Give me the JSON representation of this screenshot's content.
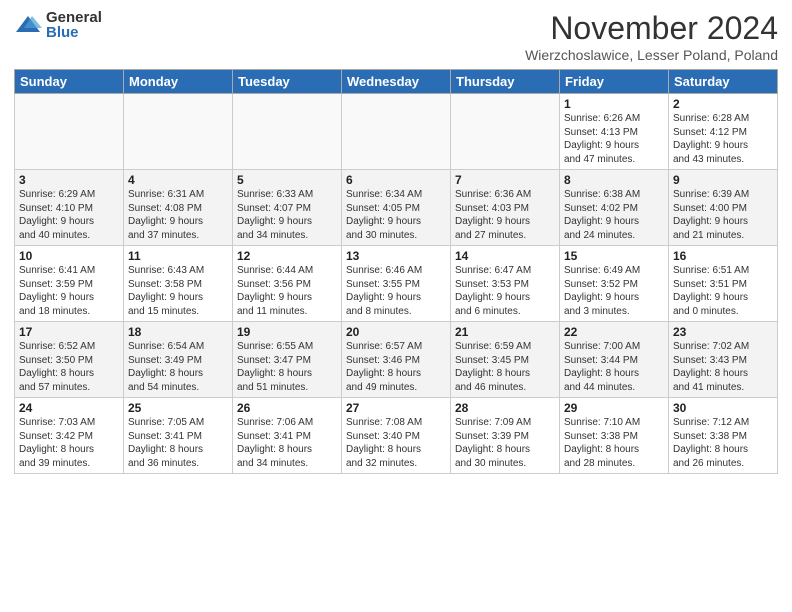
{
  "logo": {
    "general": "General",
    "blue": "Blue"
  },
  "title": "November 2024",
  "location": "Wierzchoslawice, Lesser Poland, Poland",
  "days_header": [
    "Sunday",
    "Monday",
    "Tuesday",
    "Wednesday",
    "Thursday",
    "Friday",
    "Saturday"
  ],
  "weeks": [
    [
      {
        "day": "",
        "info": ""
      },
      {
        "day": "",
        "info": ""
      },
      {
        "day": "",
        "info": ""
      },
      {
        "day": "",
        "info": ""
      },
      {
        "day": "",
        "info": ""
      },
      {
        "day": "1",
        "info": "Sunrise: 6:26 AM\nSunset: 4:13 PM\nDaylight: 9 hours\nand 47 minutes."
      },
      {
        "day": "2",
        "info": "Sunrise: 6:28 AM\nSunset: 4:12 PM\nDaylight: 9 hours\nand 43 minutes."
      }
    ],
    [
      {
        "day": "3",
        "info": "Sunrise: 6:29 AM\nSunset: 4:10 PM\nDaylight: 9 hours\nand 40 minutes."
      },
      {
        "day": "4",
        "info": "Sunrise: 6:31 AM\nSunset: 4:08 PM\nDaylight: 9 hours\nand 37 minutes."
      },
      {
        "day": "5",
        "info": "Sunrise: 6:33 AM\nSunset: 4:07 PM\nDaylight: 9 hours\nand 34 minutes."
      },
      {
        "day": "6",
        "info": "Sunrise: 6:34 AM\nSunset: 4:05 PM\nDaylight: 9 hours\nand 30 minutes."
      },
      {
        "day": "7",
        "info": "Sunrise: 6:36 AM\nSunset: 4:03 PM\nDaylight: 9 hours\nand 27 minutes."
      },
      {
        "day": "8",
        "info": "Sunrise: 6:38 AM\nSunset: 4:02 PM\nDaylight: 9 hours\nand 24 minutes."
      },
      {
        "day": "9",
        "info": "Sunrise: 6:39 AM\nSunset: 4:00 PM\nDaylight: 9 hours\nand 21 minutes."
      }
    ],
    [
      {
        "day": "10",
        "info": "Sunrise: 6:41 AM\nSunset: 3:59 PM\nDaylight: 9 hours\nand 18 minutes."
      },
      {
        "day": "11",
        "info": "Sunrise: 6:43 AM\nSunset: 3:58 PM\nDaylight: 9 hours\nand 15 minutes."
      },
      {
        "day": "12",
        "info": "Sunrise: 6:44 AM\nSunset: 3:56 PM\nDaylight: 9 hours\nand 11 minutes."
      },
      {
        "day": "13",
        "info": "Sunrise: 6:46 AM\nSunset: 3:55 PM\nDaylight: 9 hours\nand 8 minutes."
      },
      {
        "day": "14",
        "info": "Sunrise: 6:47 AM\nSunset: 3:53 PM\nDaylight: 9 hours\nand 6 minutes."
      },
      {
        "day": "15",
        "info": "Sunrise: 6:49 AM\nSunset: 3:52 PM\nDaylight: 9 hours\nand 3 minutes."
      },
      {
        "day": "16",
        "info": "Sunrise: 6:51 AM\nSunset: 3:51 PM\nDaylight: 9 hours\nand 0 minutes."
      }
    ],
    [
      {
        "day": "17",
        "info": "Sunrise: 6:52 AM\nSunset: 3:50 PM\nDaylight: 8 hours\nand 57 minutes."
      },
      {
        "day": "18",
        "info": "Sunrise: 6:54 AM\nSunset: 3:49 PM\nDaylight: 8 hours\nand 54 minutes."
      },
      {
        "day": "19",
        "info": "Sunrise: 6:55 AM\nSunset: 3:47 PM\nDaylight: 8 hours\nand 51 minutes."
      },
      {
        "day": "20",
        "info": "Sunrise: 6:57 AM\nSunset: 3:46 PM\nDaylight: 8 hours\nand 49 minutes."
      },
      {
        "day": "21",
        "info": "Sunrise: 6:59 AM\nSunset: 3:45 PM\nDaylight: 8 hours\nand 46 minutes."
      },
      {
        "day": "22",
        "info": "Sunrise: 7:00 AM\nSunset: 3:44 PM\nDaylight: 8 hours\nand 44 minutes."
      },
      {
        "day": "23",
        "info": "Sunrise: 7:02 AM\nSunset: 3:43 PM\nDaylight: 8 hours\nand 41 minutes."
      }
    ],
    [
      {
        "day": "24",
        "info": "Sunrise: 7:03 AM\nSunset: 3:42 PM\nDaylight: 8 hours\nand 39 minutes."
      },
      {
        "day": "25",
        "info": "Sunrise: 7:05 AM\nSunset: 3:41 PM\nDaylight: 8 hours\nand 36 minutes."
      },
      {
        "day": "26",
        "info": "Sunrise: 7:06 AM\nSunset: 3:41 PM\nDaylight: 8 hours\nand 34 minutes."
      },
      {
        "day": "27",
        "info": "Sunrise: 7:08 AM\nSunset: 3:40 PM\nDaylight: 8 hours\nand 32 minutes."
      },
      {
        "day": "28",
        "info": "Sunrise: 7:09 AM\nSunset: 3:39 PM\nDaylight: 8 hours\nand 30 minutes."
      },
      {
        "day": "29",
        "info": "Sunrise: 7:10 AM\nSunset: 3:38 PM\nDaylight: 8 hours\nand 28 minutes."
      },
      {
        "day": "30",
        "info": "Sunrise: 7:12 AM\nSunset: 3:38 PM\nDaylight: 8 hours\nand 26 minutes."
      }
    ]
  ]
}
